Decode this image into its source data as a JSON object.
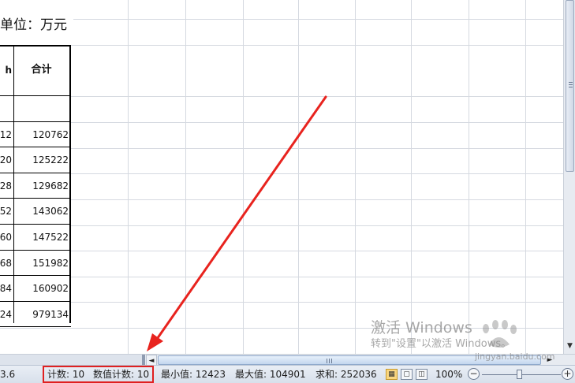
{
  "sheet": {
    "unit_label": "单位：万元",
    "table": {
      "header": {
        "left": "h",
        "right": "合计"
      },
      "rows": [
        {
          "left": "",
          "right": ""
        },
        {
          "left": "12",
          "right": "120762"
        },
        {
          "left": "20",
          "right": "125222"
        },
        {
          "left": "28",
          "right": "129682"
        },
        {
          "left": "52",
          "right": "143062"
        },
        {
          "left": "60",
          "right": "147522"
        },
        {
          "left": "68",
          "right": "151982"
        },
        {
          "left": "84",
          "right": "160902"
        },
        {
          "left": "24",
          "right": "979134"
        }
      ]
    }
  },
  "statusbar": {
    "cut_value": "3.6",
    "count": "计数: 10",
    "numeric_count": "数值计数: 10",
    "min": "最小值: 12423",
    "max": "最大值: 104901",
    "sum": "求和: 252036",
    "zoom": "100%",
    "zoom_minus": "−",
    "zoom_plus": "+"
  },
  "watermark": {
    "title": "激活 Windows",
    "subtitle": "转到\"设置\"以激活 Windows。",
    "site": "jingyan.baidu.com"
  },
  "scrollbars": {
    "left_arrow": "◄",
    "right_arrow": "►",
    "down_arrow": "▼"
  },
  "colors": {
    "highlight": "#e02020",
    "arrow": "#e8231e"
  }
}
